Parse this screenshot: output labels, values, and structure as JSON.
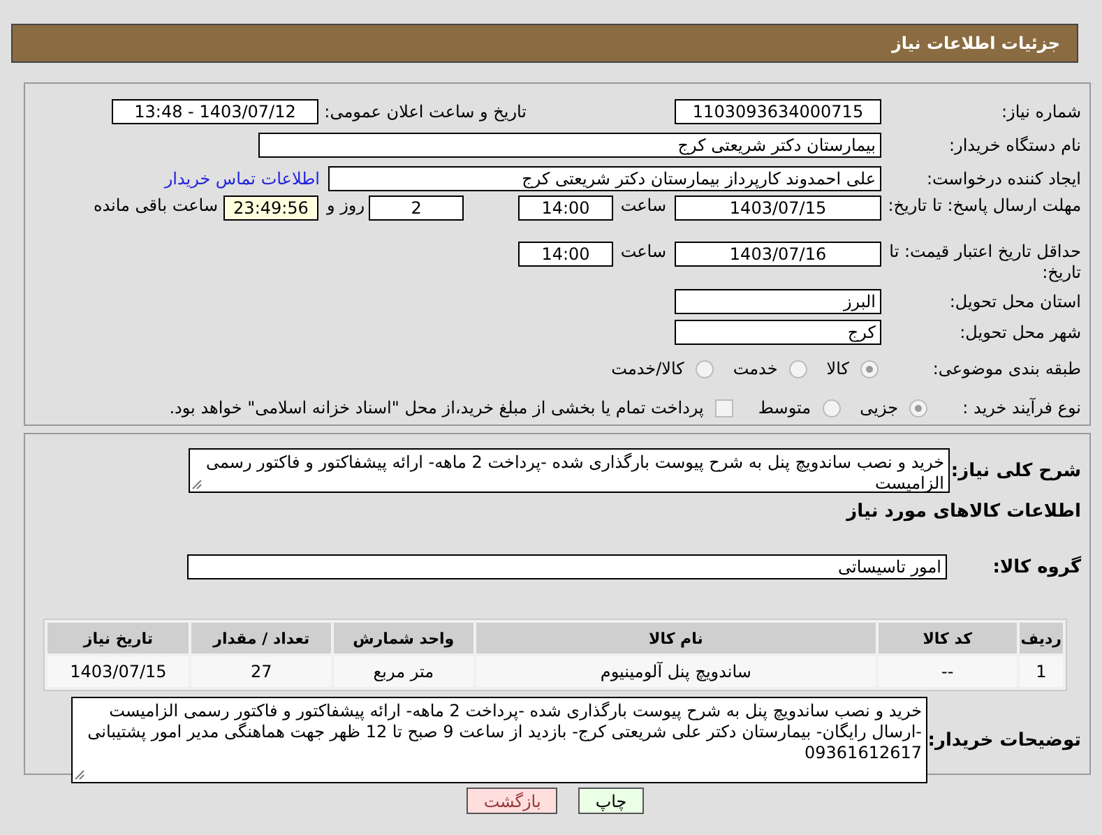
{
  "header": {
    "title": "جزئیات اطلاعات نیاز"
  },
  "need_number": {
    "label": "شماره نیاز:",
    "value": "1103093634000715"
  },
  "announce": {
    "label": "تاریخ و ساعت اعلان عمومی:",
    "value": "1403/07/12 - 13:48"
  },
  "buyer": {
    "label": "نام دستگاه خریدار:",
    "value": "بیمارستان دکتر شریعتی کرج"
  },
  "requester": {
    "label": "ایجاد کننده درخواست:",
    "value": "علی احمدوند کارپرداز بیمارستان دکتر شریعتی کرج",
    "link": "اطلاعات تماس خریدار"
  },
  "reply_deadline": {
    "label": "مهلت ارسال پاسخ: تا تاریخ:",
    "date": "1403/07/15",
    "time_label": "ساعت",
    "time": "14:00",
    "days": "2",
    "days_label": "روز و",
    "remaining": "23:49:56",
    "remaining_label": "ساعت باقی مانده"
  },
  "price_validity": {
    "label": "حداقل تاریخ اعتبار قیمت: تا تاریخ:",
    "date": "1403/07/16",
    "time_label": "ساعت",
    "time": "14:00"
  },
  "province": {
    "label": "استان محل تحویل:",
    "value": "البرز"
  },
  "city": {
    "label": "شهر محل تحویل:",
    "value": "کرج"
  },
  "category": {
    "label": "طبقه بندی موضوعی:",
    "options": [
      {
        "label": "کالا",
        "selected": true
      },
      {
        "label": "خدمت",
        "selected": false
      },
      {
        "label": "کالا/خدمت",
        "selected": false
      }
    ]
  },
  "process": {
    "label": "نوع فرآیند خرید :",
    "options": [
      {
        "label": "جزیی",
        "selected": true
      },
      {
        "label": "متوسط",
        "selected": false
      }
    ],
    "treasury": {
      "label": "پرداخت تمام یا بخشی از مبلغ خرید،از محل \"اسناد خزانه اسلامی\" خواهد بود.",
      "checked": false
    }
  },
  "summary": {
    "label": "شرح کلی نیاز:",
    "value": "خرید و نصب ساندویچ پنل به شرح پیوست بارگذاری شده -پرداخت 2 ماهه- ارائه پیشفاکتور و فاکتور رسمی الزامیست"
  },
  "goods_heading": "اطلاعات کالاهای مورد نیاز",
  "goods_group": {
    "label": "گروه کالا:",
    "value": "امور تاسیساتی"
  },
  "table": {
    "columns": [
      "ردیف",
      "کد کالا",
      "نام کالا",
      "واحد شمارش",
      "تعداد / مقدار",
      "تاریخ نیاز"
    ],
    "rows": [
      [
        "1",
        "--",
        "ساندویچ پنل آلومینیوم",
        "متر مربع",
        "27",
        "1403/07/15"
      ]
    ]
  },
  "buyer_notes": {
    "label": "توضیحات خریدار:",
    "value": "خرید و نصب ساندویچ پنل به شرح پیوست بارگذاری شده -پرداخت 2 ماهه- ارائه پیشفاکتور و فاکتور رسمی الزامیست -ارسال رایگان- بیمارستان دکتر علی شریعتی کرج- بازدید از ساعت 9 صبح تا 12 ظهر جهت هماهنگی مدیر امور پشتیبانی 09361612617"
  },
  "buttons": [
    {
      "label": "چاپ",
      "kind": "print"
    },
    {
      "label": "بازگشت",
      "kind": "back"
    }
  ]
}
